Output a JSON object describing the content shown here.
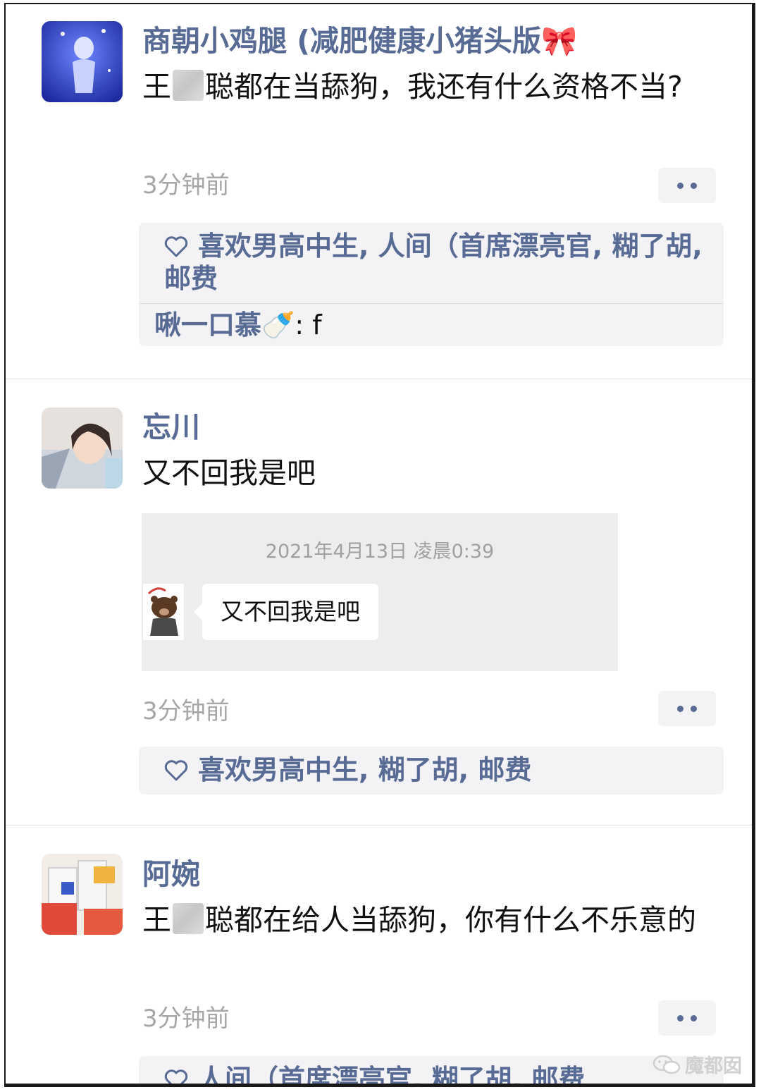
{
  "posts": [
    {
      "username": "商朝小鸡腿 (减肥健康小猪头版🎀",
      "content_before": "王",
      "content_after": "聪都在当舔狗，我还有什么资格不当?",
      "time": "3分钟前",
      "likes": "喜欢男高中生, 人间（首席漂亮官, 糊了胡, 邮费",
      "comment_name": "啾一口慕🍼",
      "comment_text": ": f"
    },
    {
      "username": "忘川",
      "content": "又不回我是吧",
      "quote_time": "2021年4月13日 凌晨0:39",
      "quote_message": "又不回我是吧",
      "time": "3分钟前",
      "likes": "喜欢男高中生, 糊了胡, 邮费"
    },
    {
      "username": "阿婉",
      "content_before": "王",
      "content_after": "聪都在给人当舔狗，你有什么不乐意的",
      "time": "3分钟前",
      "likes": "人间（首席漂亮官, 糊了胡, 邮费"
    }
  ],
  "watermark": "魔都囡",
  "colors": {
    "link": "#576b95",
    "panel": "#f3f3f5",
    "time": "#a6a6a6"
  },
  "icons": [
    "more-icon",
    "heart-icon",
    "wechat-icon"
  ]
}
